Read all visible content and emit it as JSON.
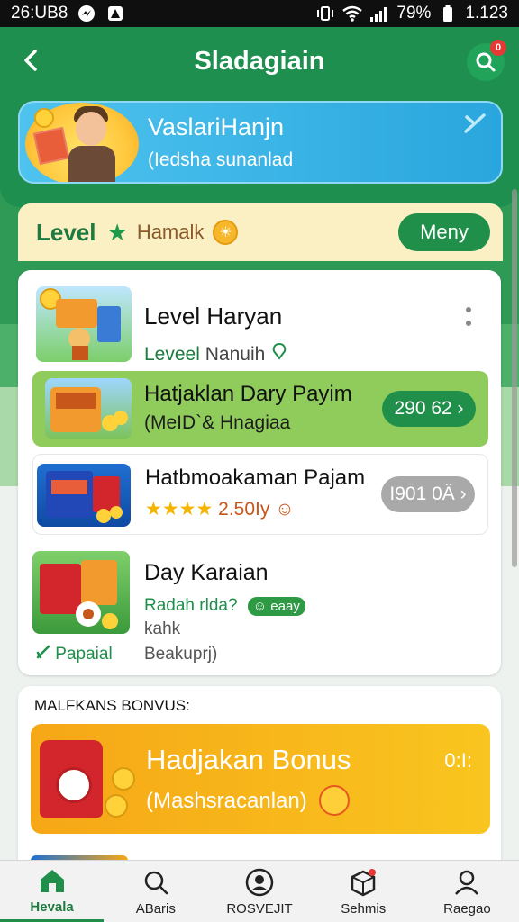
{
  "status_bar": {
    "time": "26:UB8",
    "battery": "79%",
    "right_time": "1.123"
  },
  "header": {
    "title": "Sladagiain"
  },
  "banner": {
    "title": "VaslariHanjn",
    "subtitle": "(Iedsha sunanlad"
  },
  "level_bar": {
    "label": "Level",
    "name": "Hamalk",
    "button": "Meny"
  },
  "list": [
    {
      "title": "Level Haryan",
      "sub_green": "Leveel",
      "sub_gray": "Nanuih"
    },
    {
      "title": "Hatjaklan Dary Payim",
      "subtitle": "(MeID`& Hnagiaa",
      "pill": "290 62"
    },
    {
      "title": "Hatbmoakaman Pajam",
      "stars": "★★★★",
      "subtitle": "2.50Iy",
      "pill": "I901 0Ä"
    },
    {
      "title": "Day Karaian",
      "sub_a": "Radah  rlda?",
      "tag": "eaay",
      "sub_b": "kahk",
      "sub_c": "Papaial",
      "sub_d": "Beakuprj)"
    }
  ],
  "bonus": {
    "heading": "MALFKANS BONVUS:",
    "title": "Hadjakan Bonus",
    "subtitle": "(Mashsracanlan)",
    "timer": "0:I:"
  },
  "bottom_nav": [
    {
      "label": "Hevala",
      "icon": "home-icon"
    },
    {
      "label": "ABaris",
      "icon": "search-icon"
    },
    {
      "label": "ROSVEJIT",
      "icon": "social-icon"
    },
    {
      "label": "Sehmis",
      "icon": "box-icon"
    },
    {
      "label": "Raegao",
      "icon": "profile-icon"
    }
  ],
  "colors": {
    "primary_green": "#1e8f4e",
    "banner_blue": "#2aa6de",
    "bonus_orange": "#f6a716",
    "level_bg": "#fbefc4"
  }
}
